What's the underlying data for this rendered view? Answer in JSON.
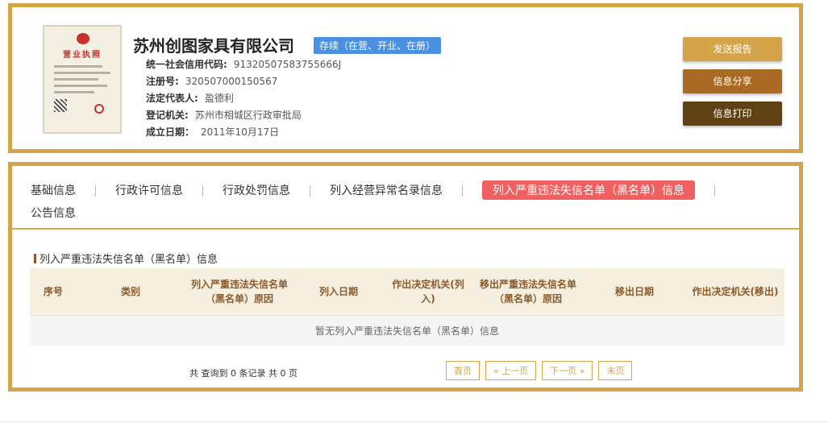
{
  "company": {
    "name": "苏州创图家具有限公司",
    "status": "存续（在营、开业、在册）",
    "fields": [
      {
        "label": "统一社会信用代码:",
        "value": "91320507583755666J"
      },
      {
        "label": "注册号:",
        "value": "320507000150567"
      },
      {
        "label": "法定代表人:",
        "value": "盈德利"
      },
      {
        "label": "登记机关:",
        "value": "苏州市相城区行政审批局"
      },
      {
        "label": "成立日期：",
        "value": "2011年10月17日"
      }
    ],
    "license_thumb": {
      "title": "营业执照"
    }
  },
  "actions": {
    "report": "发送报告",
    "share": "信息分享",
    "print": "信息打印"
  },
  "tabs": [
    {
      "label": "基础信息",
      "active": false
    },
    {
      "label": "行政许可信息",
      "active": false
    },
    {
      "label": "行政处罚信息",
      "active": false
    },
    {
      "label": "列入经营异常名录信息",
      "active": false
    },
    {
      "label": "列入严重违法失信名单（黑名单）信息",
      "active": true
    },
    {
      "label": "公告信息",
      "active": false
    }
  ],
  "blacklist": {
    "section_title": "列入严重违法失信名单（黑名单）信息",
    "columns": [
      "序号",
      "类别",
      "列入严重违法失信名单（黑名单）原因",
      "列入日期",
      "作出决定机关(列入)",
      "移出严重违法失信名单（黑名单）原因",
      "移出日期",
      "作出决定机关(移出)"
    ],
    "empty_text": "暂无列入严重违法失信名单（黑名单）信息"
  },
  "pager": {
    "total_text": "共 查询到 0 条记录 共 0 页",
    "first": "首页",
    "prev": "« 上一页",
    "next": "下一页 »",
    "last": "末页"
  },
  "colors": {
    "border": "#d4a44b",
    "badge": "#4a90e2",
    "active_tab": "#f06060",
    "btn_report": "#d4a44b",
    "btn_share": "#a96a24",
    "btn_print": "#5e4213"
  }
}
